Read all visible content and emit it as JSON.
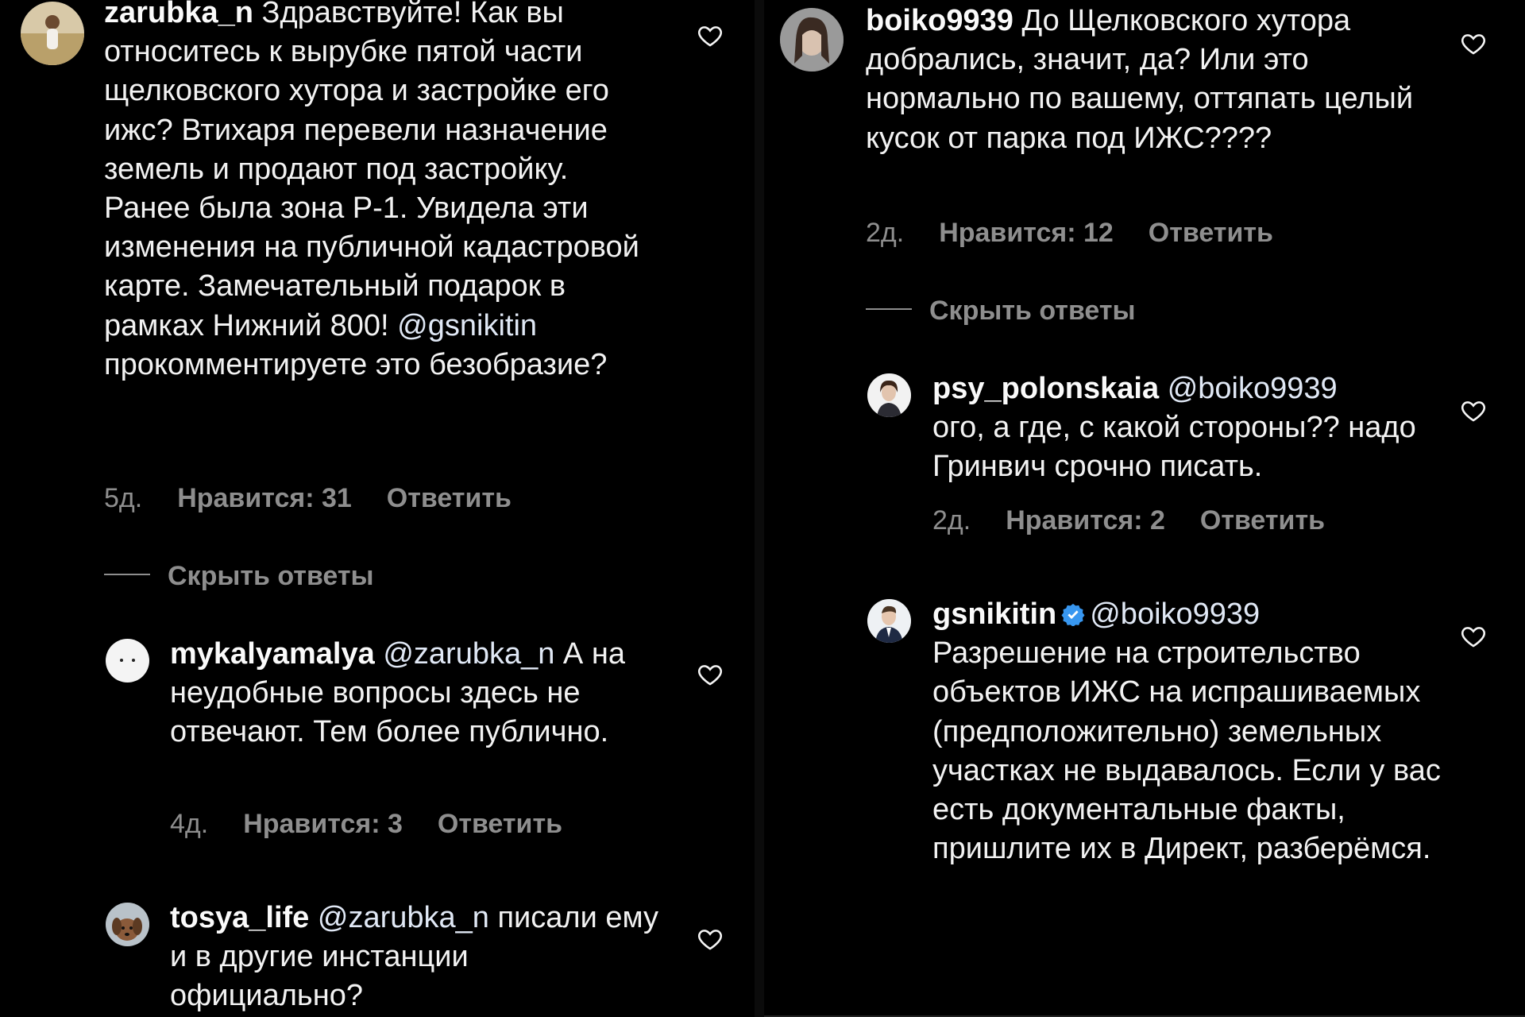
{
  "left": {
    "c1": {
      "username": "zarubka_n",
      "text_before": "Здравствуйте! Как вы относитесь к вырубке пятой части щелковского хутора и застройке его ижс? Втихаря перевели назначение земель и продают под застройку. Ранее была зона Р-1. Увидела эти изменения на публичной кадастровой карте. Замечательный подарок в рамках Нижний 800! ",
      "mention": "@gsnikitin",
      "text_after": " прокомментируете это безобразие?",
      "time": "5д.",
      "likes": "Нравится: 31",
      "reply": "Ответить"
    },
    "hide_replies": "Скрыть ответы",
    "c2": {
      "username": "mykalyamalya",
      "mention": "@zarubka_n",
      "text": " А на неудобные вопросы здесь не отвечают. Тем более публично.",
      "time": "4д.",
      "likes": "Нравится: 3",
      "reply": "Ответить"
    },
    "c3": {
      "username": "tosya_life",
      "mention": "@zarubka_n",
      "text": " писали ему и в другие инстанции официально?"
    }
  },
  "right": {
    "c1": {
      "username": "boiko9939",
      "text": "До Щелковского хутора добрались, значит, да? Или это нормально по вашему, оттяпать целый кусок от парка под ИЖС????",
      "time": "2д.",
      "likes": "Нравится: 12",
      "reply": "Ответить"
    },
    "hide_replies": "Скрыть ответы",
    "c2": {
      "username": "psy_polonskaia",
      "mention": "@boiko9939",
      "text": "ого, а где,  с какой стороны?? надо Гринвич срочно писать.",
      "time": "2д.",
      "likes": "Нравится: 2",
      "reply": "Ответить"
    },
    "c3": {
      "username": "gsnikitin",
      "mention": "@boiko9939",
      "text": "Разрешение на строительство объектов ИЖС на испрашиваемых (предположительно) земельных участках не выдавалось. Если у вас есть документальные факты, пришлите их в Директ, разберёмся."
    }
  },
  "icons": {
    "heart": "heart-outline-icon",
    "verified": "verified-badge-icon"
  },
  "colors": {
    "background": "#000000",
    "text": "#f2f2f2",
    "muted": "#8e8e8e",
    "verified": "#3897f0"
  }
}
